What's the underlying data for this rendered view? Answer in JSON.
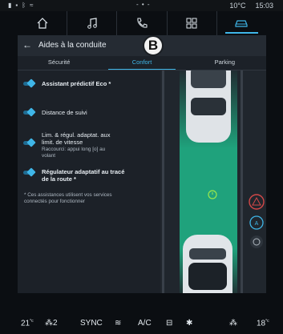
{
  "status": {
    "temperature": "10°C",
    "time": "15:03",
    "indicator": "- • -"
  },
  "header": {
    "back_glyph": "←",
    "title": "Aides à la conduite",
    "marker": "B"
  },
  "tabs": [
    {
      "label": "Sécurité"
    },
    {
      "label": "Confort"
    },
    {
      "label": "Parking"
    }
  ],
  "options": [
    {
      "label": "Assistant prédictif Eco *"
    },
    {
      "label": "Distance de suivi"
    },
    {
      "label_line1": "Lim. & régul. adaptat. aux",
      "label_line2": "limit. de vitesse",
      "sub_line1": "Raccourci: appui long [o] au",
      "sub_line2": "volant"
    },
    {
      "label_line1": "Régulateur adaptatif au tracé",
      "label_line2": "de la route *"
    }
  ],
  "note": {
    "line1": "* Ces assistances utilisent vos services",
    "line2": "connectés pour fonctionner"
  },
  "bottom": {
    "temp_left": "21",
    "temp_left_unit": "°c",
    "seat_left": "2",
    "sync": "SYNC",
    "ac": "A/C",
    "temp_right": "18",
    "temp_right_unit": "°c"
  },
  "colors": {
    "accent": "#3fb6e8",
    "lane_green": "#1fb88a",
    "warning_red": "#d24848"
  },
  "icons": {
    "nav": [
      "home-icon",
      "music-icon",
      "phone-icon",
      "apps-icon",
      "car-icon"
    ],
    "scene": [
      "distance-icon",
      "speed-limit-warning-icon",
      "adaptive-cruise-icon",
      "steering-icon"
    ]
  }
}
